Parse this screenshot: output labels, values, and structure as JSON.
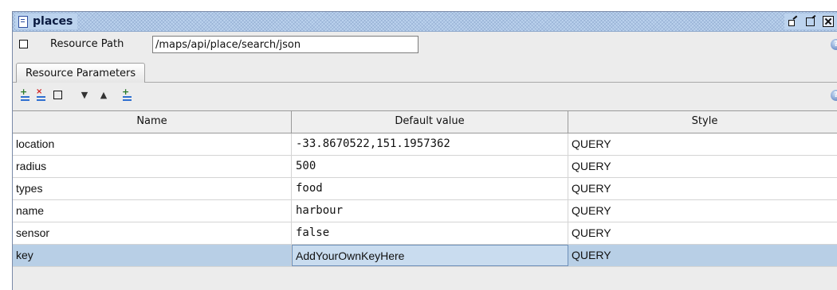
{
  "window": {
    "title": "places"
  },
  "resource_path": {
    "label": "Resource Path",
    "value": "/maps/api/place/search/json"
  },
  "tabs": [
    {
      "label": "Resource Parameters",
      "active": true
    }
  ],
  "toolbar": {
    "icons": [
      "add-parameter-icon",
      "remove-parameter-icon",
      "clear-icon",
      "move-down-icon",
      "move-up-icon",
      "add-parameters-icon",
      "help-icon"
    ]
  },
  "table": {
    "columns": [
      "Name",
      "Default value",
      "Style"
    ],
    "rows": [
      {
        "name": "location",
        "default_value": "-33.8670522,151.1957362",
        "style": "QUERY"
      },
      {
        "name": "radius",
        "default_value": "500",
        "style": "QUERY"
      },
      {
        "name": "types",
        "default_value": "food",
        "style": "QUERY"
      },
      {
        "name": "name",
        "default_value": "harbour",
        "style": "QUERY"
      },
      {
        "name": "sensor",
        "default_value": "false",
        "style": "QUERY"
      },
      {
        "name": "key",
        "default_value": "AddYourOwnKeyHere",
        "style": "QUERY",
        "selected": true
      }
    ]
  },
  "colors": {
    "titlebar": "#bcd3ee",
    "selection": "#b8cfe6"
  }
}
